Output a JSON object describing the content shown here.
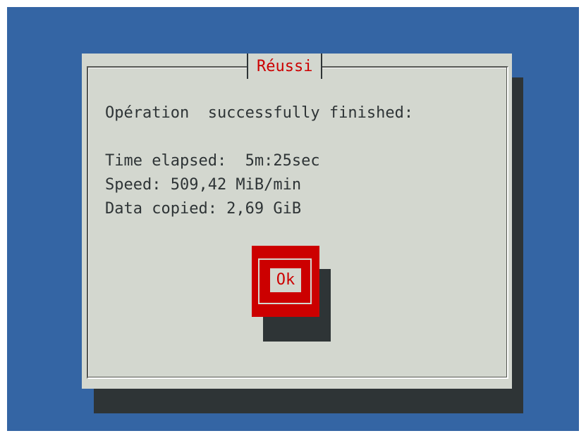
{
  "dialog": {
    "title": "Réussi",
    "message": "Opération  successfully finished:",
    "stats": {
      "time_elapsed": "Time elapsed:  5m:25sec",
      "speed": "Speed: 509,42 MiB/min",
      "data_copied": "Data copied: 2,69 GiB"
    },
    "ok_button": "Ok"
  },
  "colors": {
    "desktop": "#3465a4",
    "dialog_bg": "#d3d7cf",
    "shadow": "#2e3436",
    "accent": "#cc0000"
  }
}
